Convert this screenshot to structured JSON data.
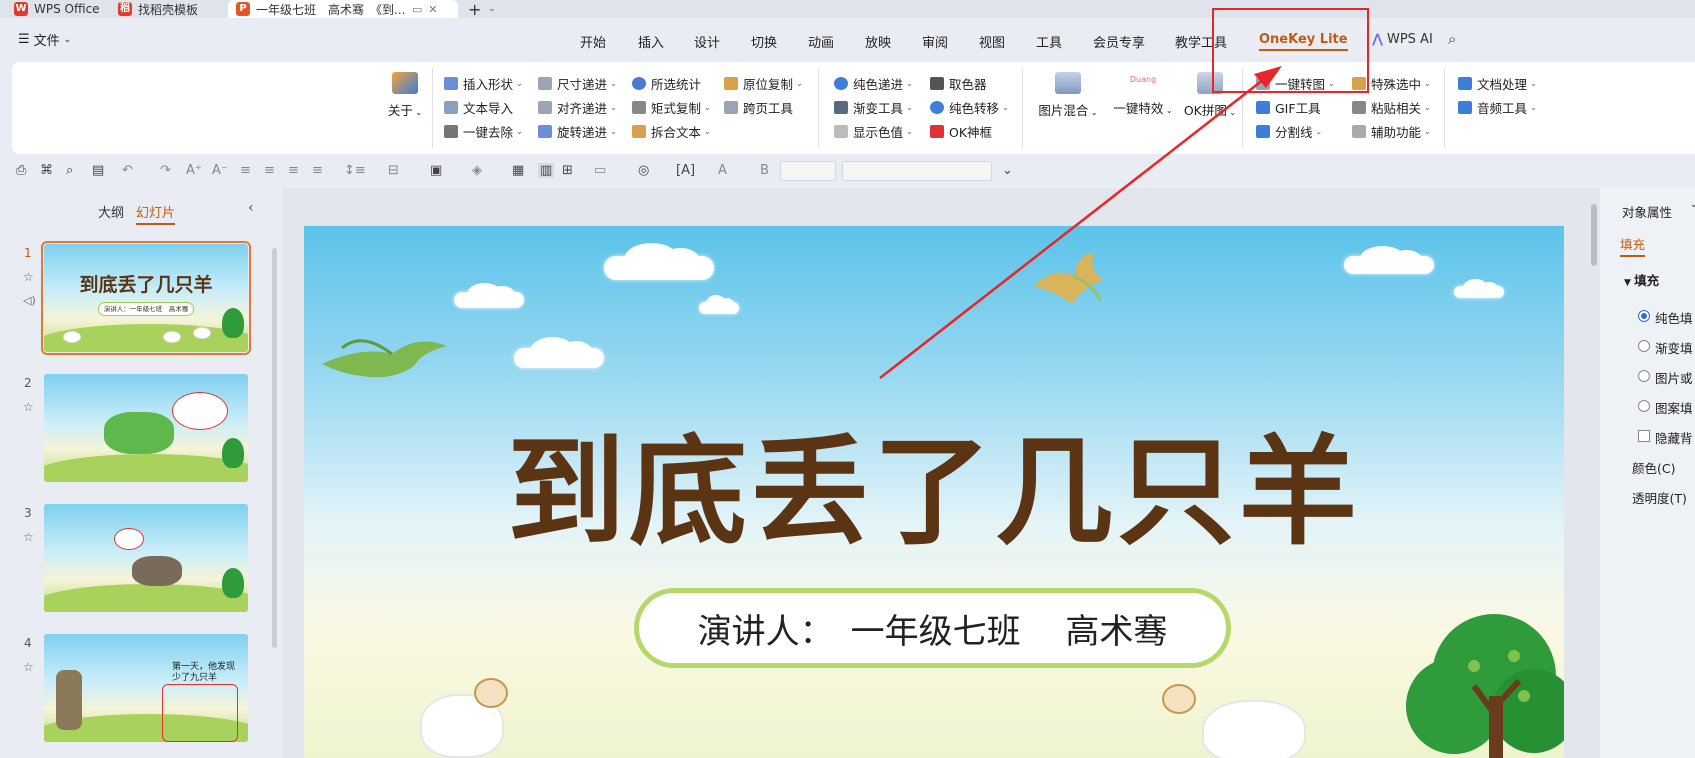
{
  "tabs": {
    "wps": "WPS Office",
    "template": "找稻壳模板",
    "doc": "一年级七班　高术骞　《到..."
  },
  "menu": {
    "file": "文件",
    "tabs": [
      "开始",
      "插入",
      "设计",
      "切换",
      "动画",
      "放映",
      "审阅",
      "视图",
      "工具",
      "会员专享",
      "教学工具"
    ],
    "onekey": "OneKey Lite",
    "wpsai": "WPS AI"
  },
  "ribbon": {
    "about": "关于",
    "col1": [
      "插入形状",
      "文本导入",
      "一键去除"
    ],
    "col2": [
      "尺寸递进",
      "对齐递进",
      "旋转递进"
    ],
    "col3": [
      "所选统计",
      "矩式复制",
      "拆合文本"
    ],
    "col4": [
      "原位复制",
      "跨页工具"
    ],
    "col5": [
      "纯色递进",
      "渐变工具",
      "显示色值"
    ],
    "col6": [
      "取色器",
      "纯色转移",
      "OK神框"
    ],
    "big": [
      "图片混合",
      "一键特效",
      "OK拼图"
    ],
    "big_label_tag": "Duang",
    "col7": [
      "一键转图",
      "GIF工具",
      "分割线"
    ],
    "col8": [
      "特殊选中",
      "粘贴相关",
      "辅助功能"
    ],
    "col9": [
      "文档处理",
      "音频工具"
    ]
  },
  "leftpanel": {
    "outline": "大纲",
    "slides": "幻灯片",
    "numbers": [
      "1",
      "2",
      "3",
      "4"
    ],
    "thumb1_title": "到底丢了几只羊",
    "thumb1_sub": "演讲人：一年级七班　高术骞",
    "thumb4_text": "第一天，他发现少了九只羊"
  },
  "slide": {
    "title": "到底丢了几只羊",
    "presenter": "演讲人：　一年级七班　 高术骞"
  },
  "rightpanel": {
    "header": "对象属性",
    "fill_tab": "填充",
    "section": "填充",
    "options": [
      "纯色填",
      "渐变填",
      "图片或",
      "图案填"
    ],
    "hide_bg": "隐藏背",
    "color": "颜色(C)",
    "transparency": "透明度(T)"
  }
}
